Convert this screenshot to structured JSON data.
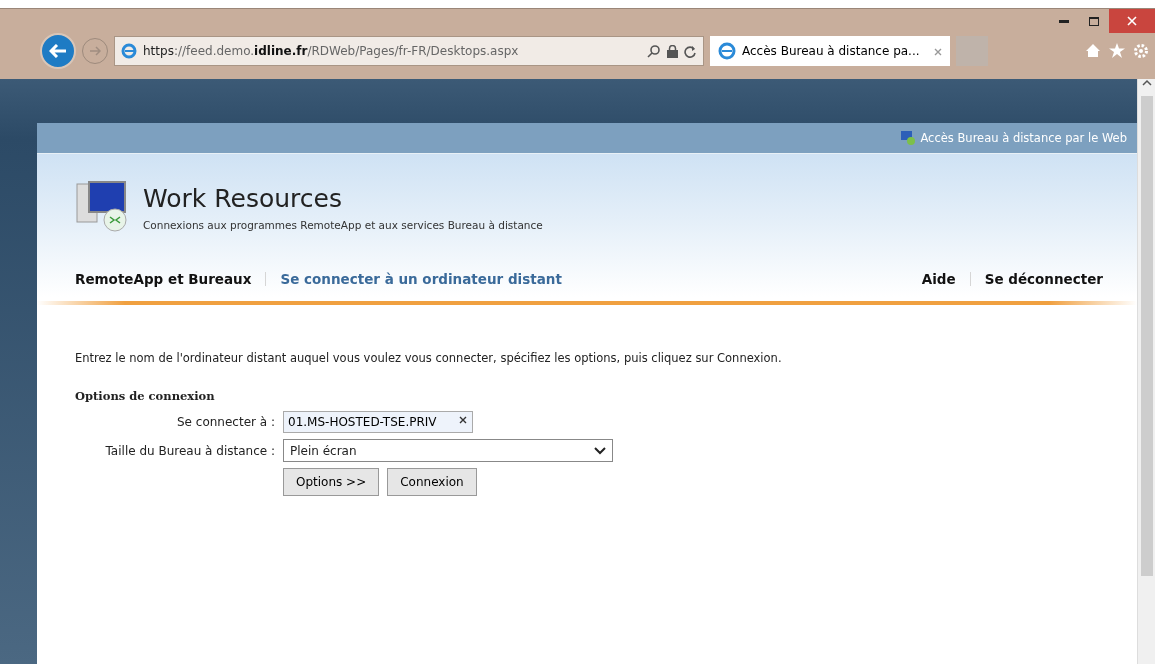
{
  "browser": {
    "address": {
      "prefix": "https://feed.demo.",
      "domain": "idline.fr",
      "path": "/RDWeb/Pages/fr-FR/Desktops.aspx"
    },
    "tabs": [
      {
        "label": "Accès Bureau à distance pa...",
        "selected": true
      }
    ]
  },
  "page": {
    "top_bar_link": "Accès Bureau à distance par le Web",
    "title": "Work Resources",
    "subtitle": "Connexions aux programmes RemoteApp et aux services Bureau à distance",
    "nav_left": [
      {
        "label": "RemoteApp et Bureaux",
        "selected": false
      },
      {
        "label": "Se connecter à un ordinateur distant",
        "selected": true
      }
    ],
    "nav_right": [
      "Aide",
      "Se déconnecter"
    ],
    "instructions": "Entrez le nom de l'ordinateur distant auquel vous voulez vous connecter, spécifiez les options, puis cliquez sur Connexion.",
    "section_title": "Options de connexion",
    "fields": [
      {
        "kind": "text",
        "label": "Se connecter à :",
        "value": "01.MS-HOSTED-TSE.PRIV"
      },
      {
        "kind": "select",
        "label": "Taille du Bureau à distance :",
        "value": "Plein écran"
      }
    ],
    "buttons": [
      "Options >>",
      "Connexion"
    ]
  }
}
